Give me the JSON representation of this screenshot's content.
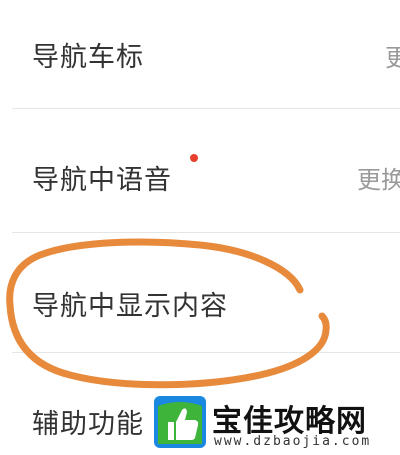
{
  "settings": {
    "rows": [
      {
        "label": "导航车标",
        "value": "更"
      },
      {
        "label": "导航中语音",
        "value": "更换",
        "has_new_dot": true
      },
      {
        "label": "导航中显示内容",
        "value": ""
      },
      {
        "label": "辅助功能",
        "value": ""
      }
    ]
  },
  "annotation": {
    "type": "hand-drawn-circle",
    "color": "#e88a3c",
    "target_row": "导航中显示内容"
  },
  "watermark": {
    "title": "宝佳攻略网",
    "url": "www.dzbaojia.com",
    "logo_icon": "thumbs-up-icon",
    "colors": {
      "green": "#3fb43a",
      "blue": "#1a88e0"
    }
  },
  "colors": {
    "label_text": "#333333",
    "value_text": "#9a9a9a",
    "divider": "#e6e6e6",
    "new_dot": "#e8402b"
  }
}
